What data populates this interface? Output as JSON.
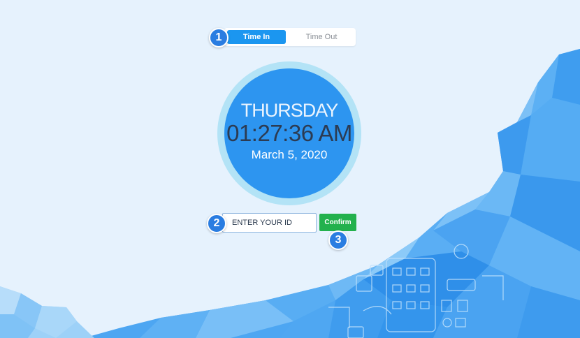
{
  "tabs": {
    "time_in": "Time In",
    "time_out": "Time Out"
  },
  "clock": {
    "day": "THURSDAY",
    "time": "01:27:36 AM",
    "date": "March 5, 2020"
  },
  "form": {
    "id_placeholder": "ENTER YOUR ID",
    "confirm_label": "Confirm"
  },
  "badges": {
    "tabs_step": "1",
    "input_step": "2",
    "confirm_step": "3"
  },
  "colors": {
    "background": "#e6f2fd",
    "accent_blue": "#1b96f0",
    "clock_face": "#2d95f0",
    "clock_ring": "#b3e3f6",
    "confirm_green": "#23b14d",
    "badge_blue": "#2a7de1"
  }
}
